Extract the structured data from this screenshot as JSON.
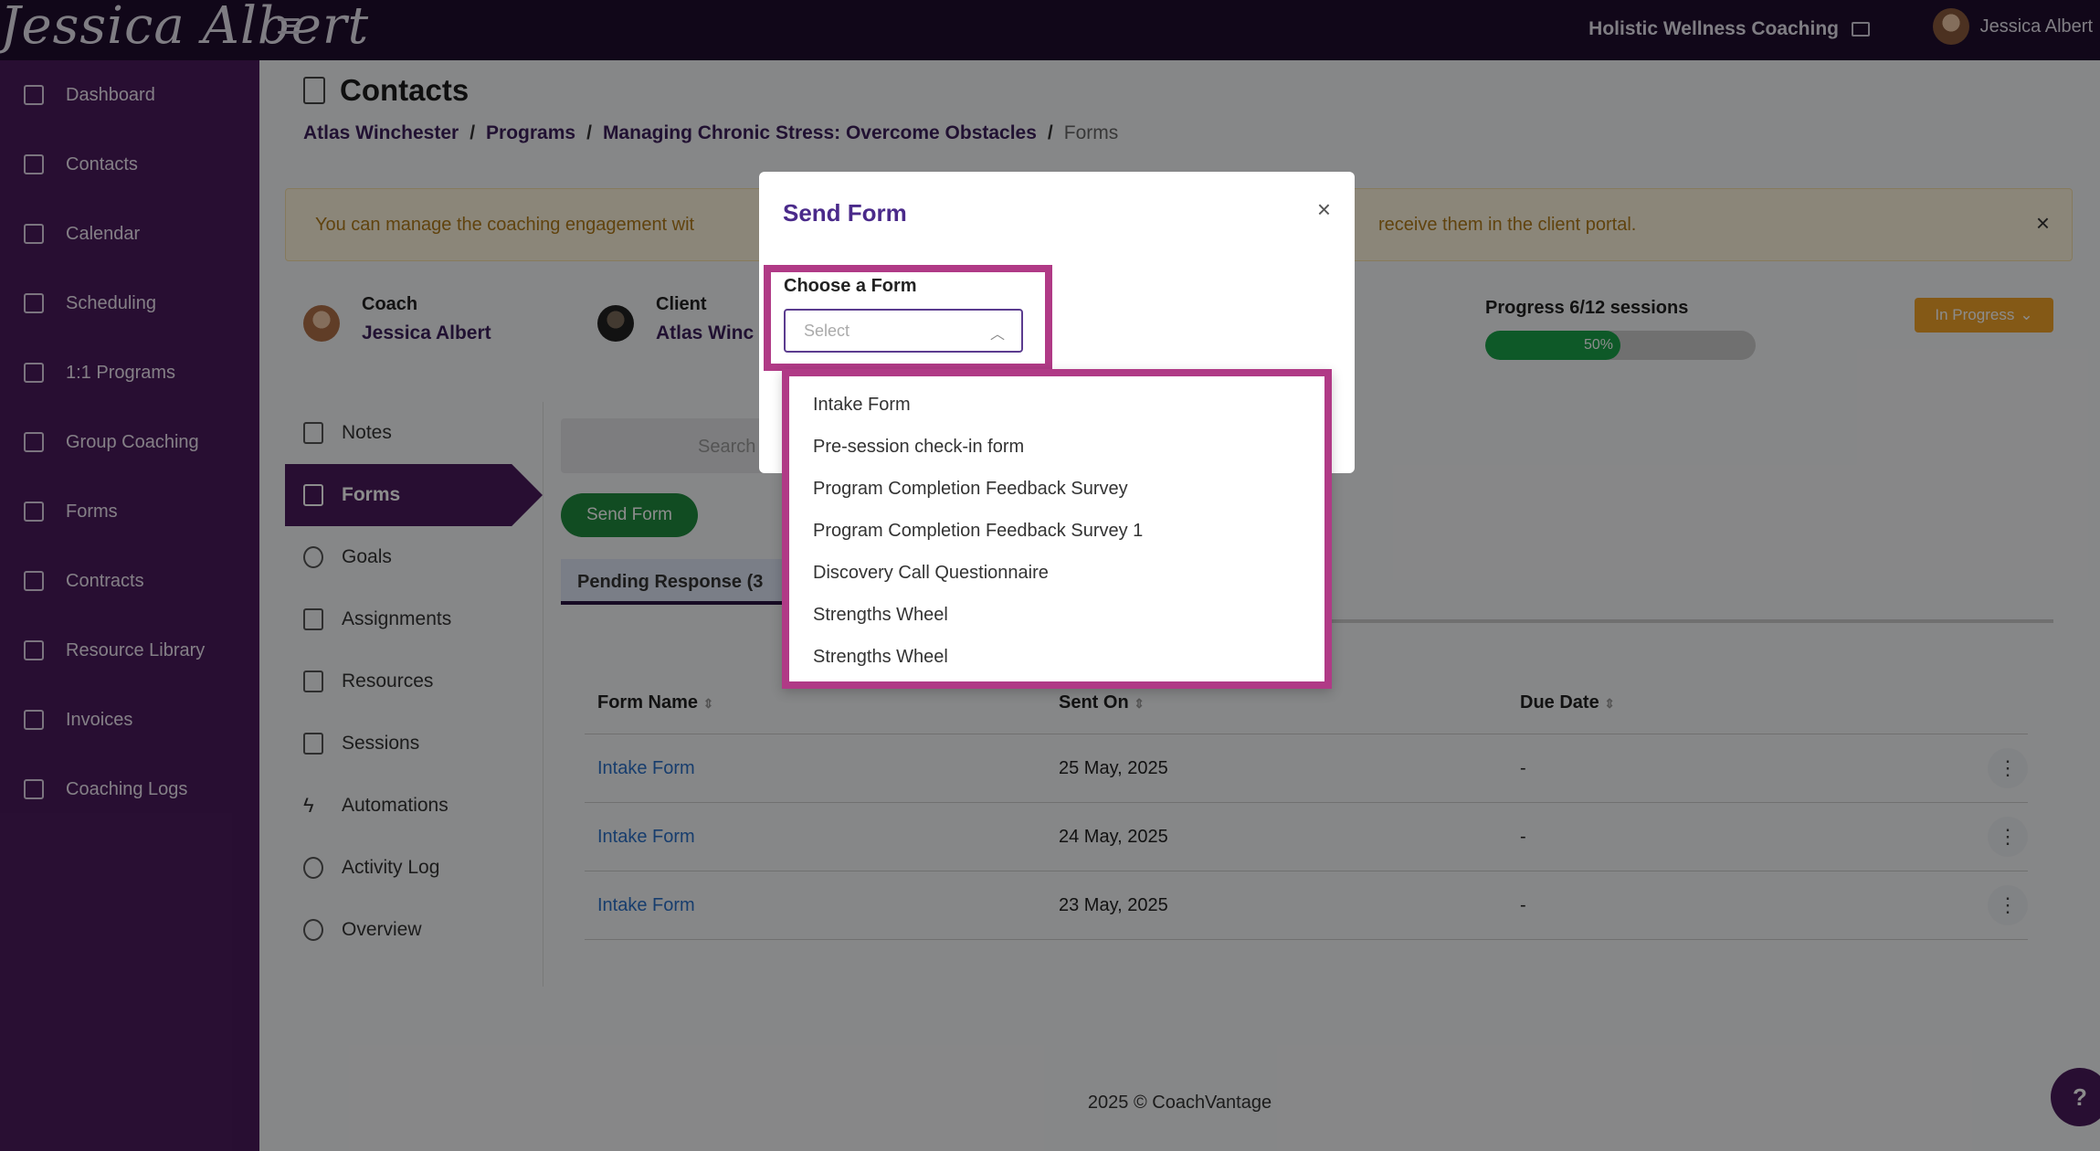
{
  "topbar": {
    "logo": "Jessica Albert",
    "org_name": "Holistic Wellness Coaching",
    "user_name": "Jessica Albert"
  },
  "sidebar": {
    "items": [
      {
        "label": "Dashboard",
        "icon": "dashboard-icon"
      },
      {
        "label": "Contacts",
        "icon": "contacts-icon"
      },
      {
        "label": "Calendar",
        "icon": "calendar-icon"
      },
      {
        "label": "Scheduling",
        "icon": "scheduling-icon"
      },
      {
        "label": "1:1 Programs",
        "icon": "book-icon"
      },
      {
        "label": "Group Coaching",
        "icon": "group-icon"
      },
      {
        "label": "Forms",
        "icon": "list-icon"
      },
      {
        "label": "Contracts",
        "icon": "contract-icon"
      },
      {
        "label": "Resource Library",
        "icon": "library-icon"
      },
      {
        "label": "Invoices",
        "icon": "invoice-icon"
      },
      {
        "label": "Coaching Logs",
        "icon": "clock-icon"
      }
    ]
  },
  "page": {
    "title": "Contacts",
    "breadcrumb": [
      "Atlas Winchester",
      "Programs",
      "Managing Chronic Stress: Overcome Obstacles",
      "Forms"
    ],
    "alert": "You can manage the coaching engagement wit",
    "alert_tail": "receive them in the client portal.",
    "coach_role": "Coach",
    "coach_name": "Jessica Albert",
    "client_role": "Client",
    "client_name": "Atlas Winc",
    "progress_label": "Progress 6/12 sessions",
    "progress_percent": 50,
    "progress_text": "50%",
    "status": "In Progress"
  },
  "subnav": [
    {
      "label": "Notes"
    },
    {
      "label": "Forms"
    },
    {
      "label": "Goals"
    },
    {
      "label": "Assignments"
    },
    {
      "label": "Resources"
    },
    {
      "label": "Sessions"
    },
    {
      "label": "Automations"
    },
    {
      "label": "Activity Log"
    },
    {
      "label": "Overview"
    }
  ],
  "forms_panel": {
    "search_placeholder": "Search",
    "send_button": "Send Form",
    "pending_tab": "Pending Response (3",
    "columns": [
      "Form Name",
      "Sent On",
      "Due Date"
    ],
    "rows": [
      {
        "name": "Intake Form",
        "sent": "25 May, 2025",
        "due": "-"
      },
      {
        "name": "Intake Form",
        "sent": "24 May, 2025",
        "due": "-"
      },
      {
        "name": "Intake Form",
        "sent": "23 May, 2025",
        "due": "-"
      }
    ]
  },
  "footer": "2025 © CoachVantage",
  "help": "?",
  "modal": {
    "title": "Send Form",
    "close": "×",
    "choose_label": "Choose a Form",
    "select_placeholder": "Select",
    "options": [
      "Intake Form",
      "Pre-session check-in form",
      "Program Completion Feedback Survey",
      "Program Completion Feedback Survey 1",
      "Discovery Call Questionnaire",
      "Strengths Wheel",
      "Strengths Wheel"
    ]
  },
  "colors": {
    "sidebar": "#4a1b5c",
    "topbar": "#1f0d2e",
    "highlight": "#b03a86",
    "accent_green": "#1f8a3e",
    "status_orange": "#f0a229"
  }
}
